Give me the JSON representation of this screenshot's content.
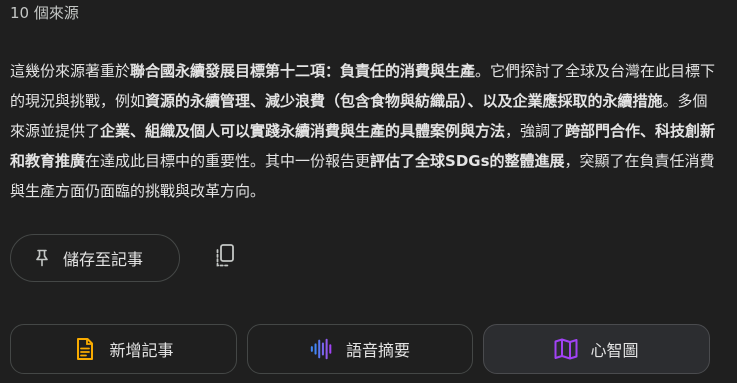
{
  "header": {
    "source_count": "10 個來源"
  },
  "summary": {
    "segments": [
      {
        "text": "這幾份來源著重於",
        "bold": false
      },
      {
        "text": "聯合國永續發展目標第十二項：負責任的消費與生產",
        "bold": true
      },
      {
        "text": "。它們探討了全球及台灣在此目標下的現況與挑戰，例如",
        "bold": false
      },
      {
        "text": "資源的永續管理、減少浪費（包含食物與紡織品）、以及企業應採取的永續措施",
        "bold": true
      },
      {
        "text": "。多個來源並提供了",
        "bold": false
      },
      {
        "text": "企業、組織及個人可以實踐永續消費與生產的具體案例與方法",
        "bold": true
      },
      {
        "text": "，強調了",
        "bold": false
      },
      {
        "text": "跨部門合作、科技創新和教育推廣",
        "bold": true
      },
      {
        "text": "在達成此目標中的重要性。其中一份報告更",
        "bold": false
      },
      {
        "text": "評估了全球SDGs的整體進展",
        "bold": true
      },
      {
        "text": "，突顯了在負責任消費與生產方面仍面臨的挑戰與改革方向。",
        "bold": false
      }
    ]
  },
  "actions": {
    "save_to_note": {
      "label": "儲存至記事",
      "icon": "pin-icon"
    },
    "copy": {
      "icon": "copy-icon"
    }
  },
  "bottom_buttons": {
    "add_note": {
      "label": "新增記事",
      "icon": "note-icon",
      "color": "#f9ab00"
    },
    "audio_overview": {
      "label": "語音摘要",
      "icon": "audio-waveform-icon",
      "color": "#4285f4"
    },
    "mind_map": {
      "label": "心智圖",
      "icon": "map-icon",
      "color": "#a142f4"
    }
  }
}
